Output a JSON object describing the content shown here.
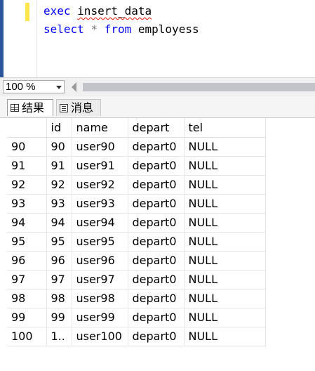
{
  "editor": {
    "line1": {
      "kw": "exec",
      "rest": "insert_data"
    },
    "line2": {
      "kw1": "select",
      "op": "*",
      "kw2": "from",
      "rest": "employess"
    }
  },
  "zoom": {
    "value": "100 %"
  },
  "tabs": [
    {
      "label": "结果",
      "icon": "grid-icon"
    },
    {
      "label": "消息",
      "icon": "message-icon"
    }
  ],
  "grid": {
    "columns": [
      "",
      "id",
      "name",
      "depart",
      "tel"
    ],
    "rows": [
      [
        "90",
        "90",
        "user90",
        "depart0",
        "NULL"
      ],
      [
        "91",
        "91",
        "user91",
        "depart0",
        "NULL"
      ],
      [
        "92",
        "92",
        "user92",
        "depart0",
        "NULL"
      ],
      [
        "93",
        "93",
        "user93",
        "depart0",
        "NULL"
      ],
      [
        "94",
        "94",
        "user94",
        "depart0",
        "NULL"
      ],
      [
        "95",
        "95",
        "user95",
        "depart0",
        "NULL"
      ],
      [
        "96",
        "96",
        "user96",
        "depart0",
        "NULL"
      ],
      [
        "97",
        "97",
        "user97",
        "depart0",
        "NULL"
      ],
      [
        "98",
        "98",
        "user98",
        "depart0",
        "NULL"
      ],
      [
        "99",
        "99",
        "user99",
        "depart0",
        "NULL"
      ],
      [
        "100",
        "1..",
        "user100",
        "depart0",
        "NULL"
      ]
    ]
  }
}
